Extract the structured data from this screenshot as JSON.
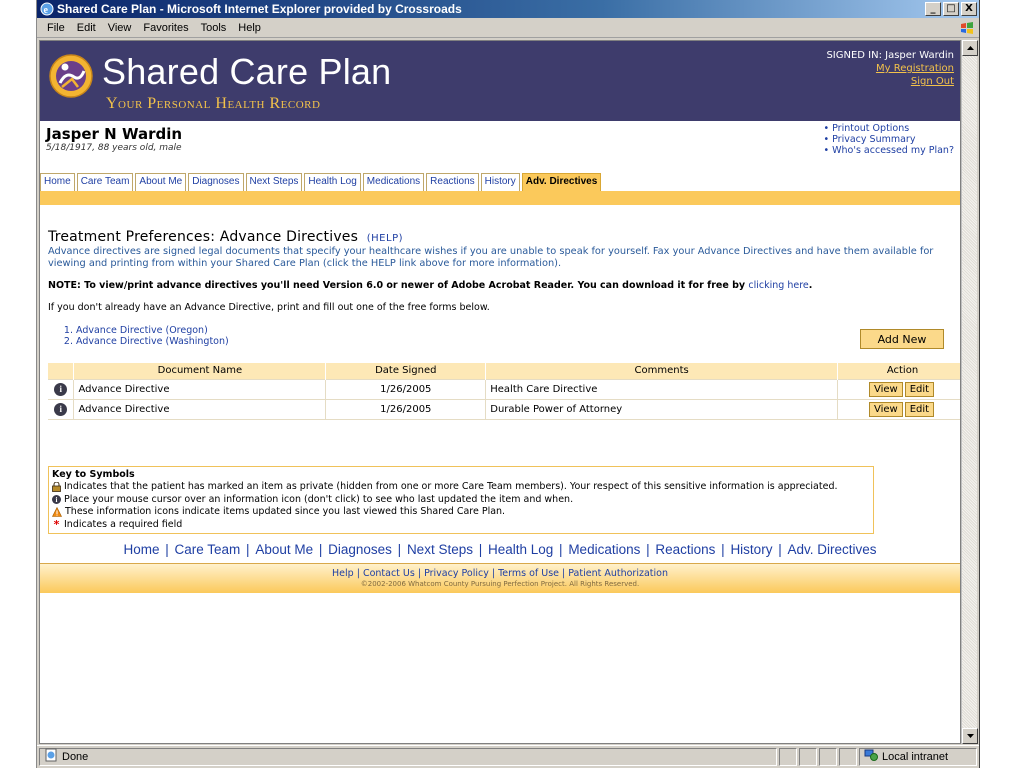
{
  "window": {
    "title": "Shared Care Plan - Microsoft Internet Explorer provided by Crossroads",
    "min_glyph": "_",
    "max_glyph": "□",
    "close_glyph": "X"
  },
  "menu": {
    "items": [
      "File",
      "Edit",
      "View",
      "Favorites",
      "Tools",
      "Help"
    ]
  },
  "site": {
    "brand": "Shared Care Plan",
    "tagline": "Your Personal Health Record",
    "signed_in": "SIGNED IN: Jasper Wardin",
    "my_registration": "My Registration",
    "sign_out": "Sign Out",
    "colors": {
      "header": "#3e3c6c",
      "accent": "#fbc95b",
      "link": "#1f3fa3"
    }
  },
  "patient": {
    "name": "Jasper N Wardin",
    "info": "5/18/1917, 88 years old, male",
    "links": [
      "Printout Options",
      "Privacy Summary",
      "Who's accessed my Plan?"
    ]
  },
  "tabs": [
    {
      "label": "Home"
    },
    {
      "label": "Care Team"
    },
    {
      "label": "About Me"
    },
    {
      "label": "Diagnoses"
    },
    {
      "label": "Next Steps"
    },
    {
      "label": "Health Log"
    },
    {
      "label": "Medications"
    },
    {
      "label": "Reactions"
    },
    {
      "label": "History"
    },
    {
      "label": "Adv. Directives"
    }
  ],
  "page": {
    "title": "Treatment Preferences: Advance Directives",
    "help": "(HELP)",
    "intro": "Advance directives are signed legal documents that specify your healthcare wishes if you are unable to speak for yourself. Fax your Advance Directives and have them available for viewing and printing from within your Shared Care Plan (click the HELP link above for more information).",
    "note": "NOTE: To view/print advance directives you'll need Version 6.0 or newer of Adobe Acrobat Reader. You can download it for free by",
    "note_link": "clicking here",
    "note_end": ".",
    "plain": "If you don't already have an Advance Directive, print and fill out one of the free forms below.",
    "forms": [
      "Advance Directive (Oregon)",
      "Advance Directive (Washington)"
    ],
    "add_new": "Add New"
  },
  "table": {
    "headers": [
      "Document Name",
      "Date Signed",
      "Comments",
      "Action"
    ],
    "rows": [
      {
        "name": "Advance Directive",
        "date": "1/26/2005",
        "comment": "Health Care Directive",
        "view": "View",
        "edit": "Edit",
        "info_glyph": "i"
      },
      {
        "name": "Advance Directive",
        "date": "1/26/2005",
        "comment": "Durable Power of Attorney",
        "view": "View",
        "edit": "Edit",
        "info_glyph": "i"
      }
    ]
  },
  "key": {
    "title": "Key to Symbols",
    "rows": [
      {
        "icon": "lock-icon",
        "text": "Indicates that the patient has marked an item as private (hidden from one or more Care Team members). Your respect of this sensitive information is appreciated."
      },
      {
        "icon": "info-icon",
        "text": "Place your mouse cursor over an information icon (don't click) to see who last updated the item and when."
      },
      {
        "icon": "warning-icon",
        "text": "These information icons indicate items updated since you last viewed this Shared Care Plan."
      },
      {
        "icon": "asterisk-icon",
        "text": "Indicates a required field"
      }
    ],
    "info_glyph": "i",
    "required_glyph": "*"
  },
  "bottom_nav": [
    "Home",
    "Care Team",
    "About Me",
    "Diagnoses",
    "Next Steps",
    "Health Log",
    "Medications",
    "Reactions",
    "History",
    "Adv. Directives"
  ],
  "footer": {
    "links": [
      "Help",
      "Contact Us",
      "Privacy Policy",
      "Terms of Use",
      "Patient Authorization"
    ],
    "copyright": "©2002-2006 Whatcom County Pursuing Perfection Project. All Rights Reserved."
  },
  "status": {
    "done": "Done",
    "zone": "Local intranet"
  }
}
